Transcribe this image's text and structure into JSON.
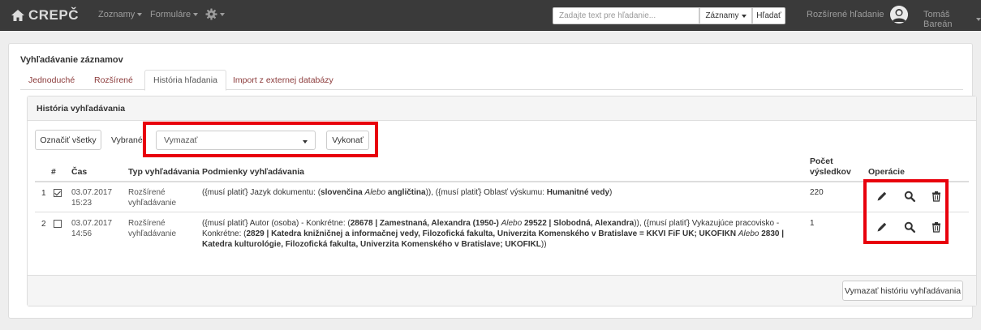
{
  "navbar": {
    "brand": "CREPČ",
    "menu_lists": "Zoznamy",
    "menu_forms": "Formuláre",
    "search_placeholder": "Zadajte text pre hľadanie...",
    "search_scope": "Záznamy",
    "search_button": "Hľadať",
    "advanced_search": "Rozšírené hľadanie",
    "user_name": "Tomáš Bareán"
  },
  "page": {
    "title": "Vyhľadávanie záznamov",
    "tabs": [
      "Jednoduché",
      "Rozšírené",
      "História hľadania",
      "Import z externej databázy"
    ]
  },
  "panel": {
    "heading": "História vyhľadávania",
    "select_all": "Označiť všetky",
    "selected_label": "Vybrané",
    "action_value": "Vymazať",
    "execute": "Vykonať",
    "clear_history": "Vymazať históriu vyhľadávania"
  },
  "table": {
    "headers": {
      "num": "#",
      "time": "Čas",
      "type": "Typ vyhľadávania",
      "conditions": "Podmienky vyhľadávania",
      "count_line1": "Počet",
      "count_line2": "výsledkov",
      "ops": "Operácie"
    },
    "rows": [
      {
        "num": "1",
        "checked": true,
        "date": "03.07.2017",
        "time": "15:23",
        "type_line1": "Rozšírené",
        "type_line2": "vyhľadávanie",
        "cond_parts": [
          [
            "t",
            "({musí platiť} Jazyk dokumentu: ("
          ],
          [
            "b",
            "slovenčina"
          ],
          [
            "t",
            " "
          ],
          [
            "i",
            "Alebo"
          ],
          [
            "t",
            " "
          ],
          [
            "b",
            "angličtina"
          ],
          [
            "t",
            ")), ({musí platiť} Oblasť výskumu: "
          ],
          [
            "b",
            "Humanitné vedy"
          ],
          [
            "t",
            ")"
          ]
        ],
        "count": "220"
      },
      {
        "num": "2",
        "checked": false,
        "date": "03.07.2017",
        "time": "14:56",
        "type_line1": "Rozšírené",
        "type_line2": "vyhľadávanie",
        "cond_parts": [
          [
            "t",
            "({musí platiť} Autor (osoba) - Konkrétne: ("
          ],
          [
            "b",
            "28678 | Zamestnaná, Alexandra (1950-)"
          ],
          [
            "t",
            " "
          ],
          [
            "i",
            "Alebo"
          ],
          [
            "t",
            " "
          ],
          [
            "b",
            "29522 | Slobodná, Alexandra"
          ],
          [
            "t",
            ")), ({musí platiť} Vykazujúce pracovisko - Konkrétne: ("
          ],
          [
            "b",
            "2829 | Katedra knižničnej a informačnej vedy, Filozofická fakulta, Univerzita Komenského v Bratislave = KKVI FiF UK; UKOFIKN"
          ],
          [
            "t",
            " "
          ],
          [
            "i",
            "Alebo"
          ],
          [
            "t",
            " "
          ],
          [
            "b",
            "2830 | Katedra kulturológie, Filozofická fakulta, Univerzita Komenského v Bratislave; UKOFIKL"
          ],
          [
            "t",
            "))"
          ]
        ],
        "count": "1"
      }
    ]
  },
  "colors": {
    "navbar": "#3a3a3a",
    "highlight": "#e8000c",
    "tab_link": "#8b3a3a"
  },
  "icons": [
    "home-icon",
    "gear-icon",
    "user-avatar-icon",
    "pencil-icon",
    "search-icon",
    "trash-icon"
  ]
}
